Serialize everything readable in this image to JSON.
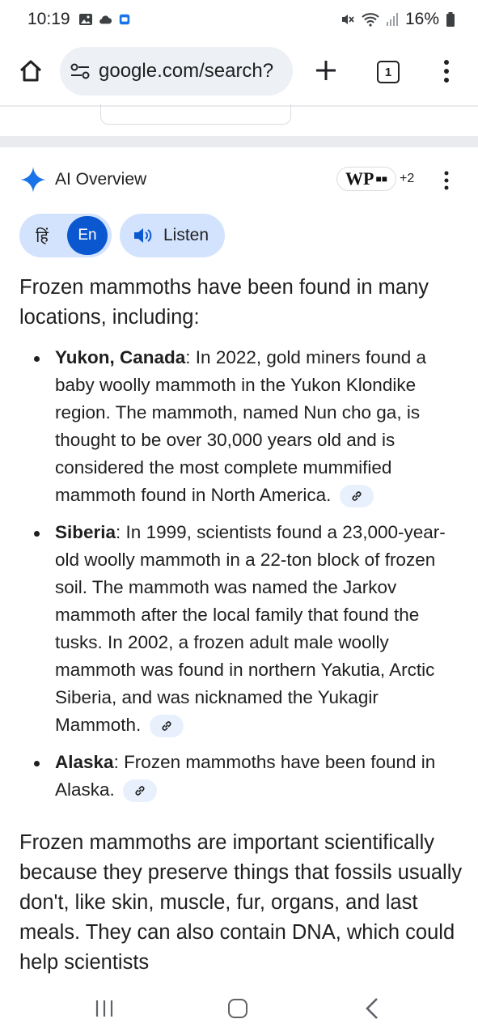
{
  "status_bar": {
    "time": "10:19",
    "battery": "16%"
  },
  "browser": {
    "url": "google.com/search?",
    "tab_count": "1"
  },
  "ai_overview": {
    "title": "AI Overview",
    "sources_logo": "WP",
    "sources_more": "+2",
    "lang_hindi": "हिं",
    "lang_english": "En",
    "listen_label": "Listen",
    "intro": "Frozen mammoths have been found in many locations, including:",
    "items": [
      {
        "term": "Yukon, Canada",
        "text": ": In 2022, gold miners found a baby woolly mammoth in the Yukon Klondike region. The mammoth, named Nun cho ga, is thought to be over 30,000 years old and is considered the most complete mummified mammoth found in North America."
      },
      {
        "term": "Siberia",
        "text": ": In 1999, scientists found a 23,000-year-old woolly mammoth in a 22-ton block of frozen soil. The mammoth was named the Jarkov mammoth after the local family that found the tusks. In 2002, a frozen adult male woolly mammoth was found in northern Yakutia, Arctic Siberia, and was nicknamed the Yukagir Mammoth."
      },
      {
        "term": "Alaska",
        "text": ": Frozen mammoths have been found in Alaska."
      }
    ],
    "paragraph2": "Frozen mammoths are important scientifically because they preserve things that fossils usually don't, like skin, muscle, fur, organs, and last meals. They can also contain DNA, which could help scientists"
  },
  "colors": {
    "accent": "#0b57d0",
    "chip_bg": "#d3e3fd",
    "text": "#1f1f1f"
  },
  "icons": [
    "home-icon",
    "tune-icon",
    "plus-icon",
    "tabs-icon",
    "overflow-menu-icon",
    "sparkle-icon",
    "speaker-icon",
    "link-icon",
    "recent-apps-icon",
    "home-nav-icon",
    "back-icon"
  ]
}
